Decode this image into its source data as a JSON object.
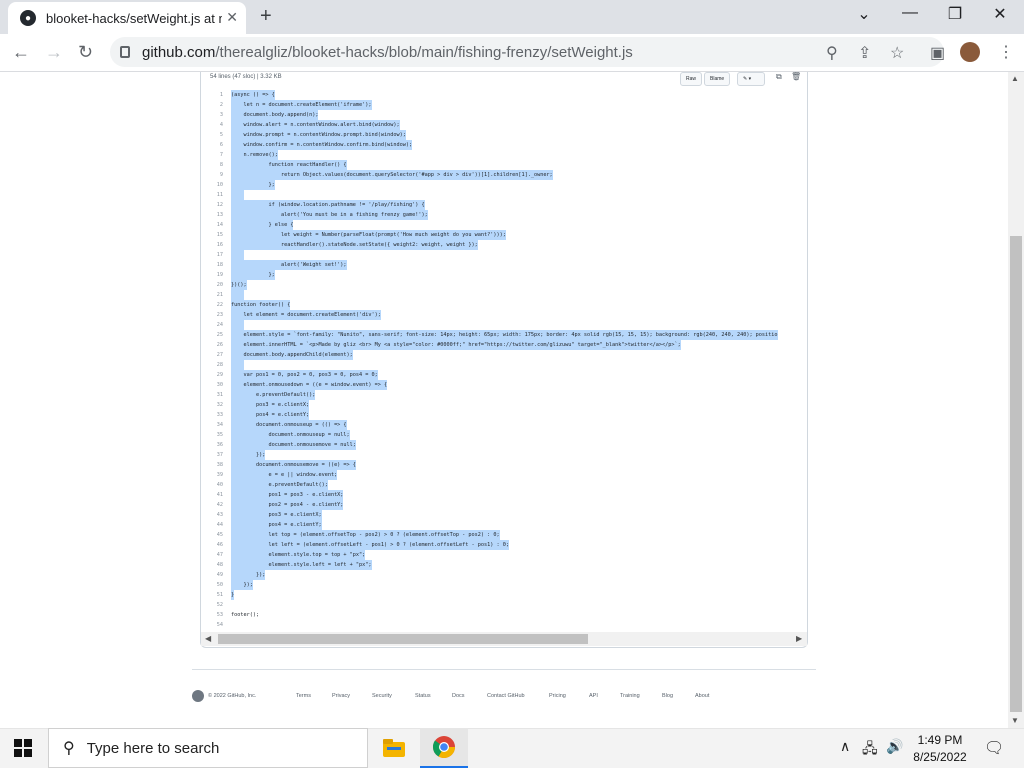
{
  "browser": {
    "tab_title": "blooket-hacks/setWeight.js at main",
    "url_host": "github.com",
    "url_path": "/therealgliz/blooket-hacks/blob/main/fishing-frenzy/setWeight.js"
  },
  "file": {
    "info": "54 lines (47 sloc)   |   3.32 KB",
    "raw_label": "Raw",
    "blame_label": "Blame"
  },
  "code_lines": [
    {
      "n": "1",
      "t": "(async () => {",
      "sel": true
    },
    {
      "n": "2",
      "t": "    let n = document.createElement('iframe');",
      "sel": true
    },
    {
      "n": "3",
      "t": "    document.body.append(n);",
      "sel": true
    },
    {
      "n": "4",
      "t": "    window.alert = n.contentWindow.alert.bind(window);",
      "sel": true
    },
    {
      "n": "5",
      "t": "    window.prompt = n.contentWindow.prompt.bind(window);",
      "sel": true
    },
    {
      "n": "6",
      "t": "    window.confirm = n.contentWindow.confirm.bind(window);",
      "sel": true
    },
    {
      "n": "7",
      "t": "    n.remove();",
      "sel": true
    },
    {
      "n": "8",
      "t": "            function reactHandler() {",
      "sel": true
    },
    {
      "n": "9",
      "t": "                return Object.values(document.querySelector('#app > div > div'))[1].children[1]._owner;",
      "sel": true
    },
    {
      "n": "10",
      "t": "            };",
      "sel": true
    },
    {
      "n": "11",
      "t": "",
      "sel": true
    },
    {
      "n": "12",
      "t": "            if (window.location.pathname != '/play/fishing') {",
      "sel": true
    },
    {
      "n": "13",
      "t": "                alert('You must be in a fishing frenzy game!');",
      "sel": true
    },
    {
      "n": "14",
      "t": "            } else {",
      "sel": true
    },
    {
      "n": "15",
      "t": "                let weight = Number(parseFloat(prompt('How much weight do you want?')));",
      "sel": true
    },
    {
      "n": "16",
      "t": "                reactHandler().stateNode.setState({ weight2: weight, weight });",
      "sel": true
    },
    {
      "n": "17",
      "t": "",
      "sel": true
    },
    {
      "n": "18",
      "t": "                alert('Weight set!');",
      "sel": true
    },
    {
      "n": "19",
      "t": "            };",
      "sel": true
    },
    {
      "n": "20",
      "t": "})();",
      "sel": true
    },
    {
      "n": "21",
      "t": "",
      "sel": true
    },
    {
      "n": "22",
      "t": "function footer() {",
      "sel": true
    },
    {
      "n": "23",
      "t": "    let element = document.createElement('div');",
      "sel": true
    },
    {
      "n": "24",
      "t": "",
      "sel": true
    },
    {
      "n": "25",
      "t": "    element.style = `font-family: \"Nunito\", sans-serif; font-size: 14px; height: 65px; width: 175px; border: 4px solid rgb(15, 15, 15); background: rgb(240, 240, 240); positio",
      "sel": true
    },
    {
      "n": "26",
      "t": "    element.innerHTML = `<p>Made by gliz <br> My <a style=\"color: #0000ff;\" href=\"https://twitter.com/glizuwu\" target=\"_blank\">twitter</a></p>`;",
      "sel": true
    },
    {
      "n": "27",
      "t": "    document.body.appendChild(element);",
      "sel": true
    },
    {
      "n": "28",
      "t": "",
      "sel": true
    },
    {
      "n": "29",
      "t": "    var pos1 = 0, pos2 = 0, pos3 = 0, pos4 = 0;",
      "sel": true
    },
    {
      "n": "30",
      "t": "    element.onmousedown = ((e = window.event) => {",
      "sel": true
    },
    {
      "n": "31",
      "t": "        e.preventDefault();",
      "sel": true
    },
    {
      "n": "32",
      "t": "        pos3 = e.clientX;",
      "sel": true
    },
    {
      "n": "33",
      "t": "        pos4 = e.clientY;",
      "sel": true
    },
    {
      "n": "34",
      "t": "        document.onmouseup = (() => {",
      "sel": true
    },
    {
      "n": "35",
      "t": "            document.onmouseup = null;",
      "sel": true
    },
    {
      "n": "36",
      "t": "            document.onmousemove = null;",
      "sel": true
    },
    {
      "n": "37",
      "t": "        });",
      "sel": true
    },
    {
      "n": "38",
      "t": "        document.onmousemove = ((e) => {",
      "sel": true
    },
    {
      "n": "39",
      "t": "            e = e || window.event;",
      "sel": true
    },
    {
      "n": "40",
      "t": "            e.preventDefault();",
      "sel": true
    },
    {
      "n": "41",
      "t": "            pos1 = pos3 - e.clientX;",
      "sel": true
    },
    {
      "n": "42",
      "t": "            pos2 = pos4 - e.clientY;",
      "sel": true
    },
    {
      "n": "43",
      "t": "            pos3 = e.clientX;",
      "sel": true
    },
    {
      "n": "44",
      "t": "            pos4 = e.clientY;",
      "sel": true
    },
    {
      "n": "45",
      "t": "            let top = (element.offsetTop - pos2) > 0 ? (element.offsetTop - pos2) : 0;",
      "sel": true
    },
    {
      "n": "46",
      "t": "            let left = (element.offsetLeft - pos1) > 0 ? (element.offsetLeft - pos1) : 0;",
      "sel": true
    },
    {
      "n": "47",
      "t": "            element.style.top = top + \"px\";",
      "sel": true
    },
    {
      "n": "48",
      "t": "            element.style.left = left + \"px\";",
      "sel": true
    },
    {
      "n": "49",
      "t": "        });",
      "sel": true
    },
    {
      "n": "50",
      "t": "    });",
      "sel": true
    },
    {
      "n": "51",
      "t": "}",
      "sel": true
    },
    {
      "n": "52",
      "t": "",
      "sel": false
    },
    {
      "n": "53",
      "t": "footer();",
      "sel": false
    },
    {
      "n": "54",
      "t": "",
      "sel": false
    }
  ],
  "footer": {
    "copyright": "© 2022 GitHub, Inc.",
    "links": [
      "Terms",
      "Privacy",
      "Security",
      "Status",
      "Docs",
      "Contact GitHub",
      "Pricing",
      "API",
      "Training",
      "Blog",
      "About"
    ]
  },
  "taskbar": {
    "search_placeholder": "Type here to search",
    "time": "1:49 PM",
    "date": "8/25/2022"
  }
}
